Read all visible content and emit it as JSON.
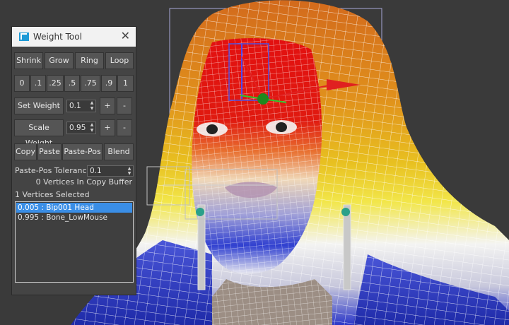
{
  "window": {
    "title": "Weight Tool",
    "logo_icon": "3dsmax-logo-icon",
    "close_glyph": "✕"
  },
  "buttons": {
    "shrink": "Shrink",
    "grow": "Grow",
    "ring": "Ring",
    "loop": "Loop",
    "presets": [
      "0",
      ".1",
      ".25",
      ".5",
      ".75",
      ".9",
      "1"
    ],
    "set_weight": "Set Weight",
    "scale_weight": "Scale Weight",
    "plus": "+",
    "minus": "-",
    "copy": "Copy",
    "paste": "Paste",
    "paste_pos": "Paste-Pos",
    "blend": "Blend"
  },
  "fields": {
    "set_weight_value": "0.1",
    "scale_weight_value": "0.95",
    "paste_pos_tolerance_label": "Paste-Pos Tolerance",
    "paste_pos_tolerance_value": "0.1"
  },
  "status": {
    "copy_buffer": "0 Vertices In Copy Buffer",
    "selected": "1 Vertices Selected"
  },
  "weights_list": [
    {
      "text": "0.005 : Bip001 Head",
      "selected": true
    },
    {
      "text": "0.995 : Bone_LowMouse",
      "selected": false
    }
  ],
  "colors": {
    "panel_bg": "#444444",
    "selection": "#3a8ee6",
    "viewport_bg": "#3a3a3a",
    "gizmo_x": "#e02020",
    "gizmo_y": "#2ec82e"
  }
}
